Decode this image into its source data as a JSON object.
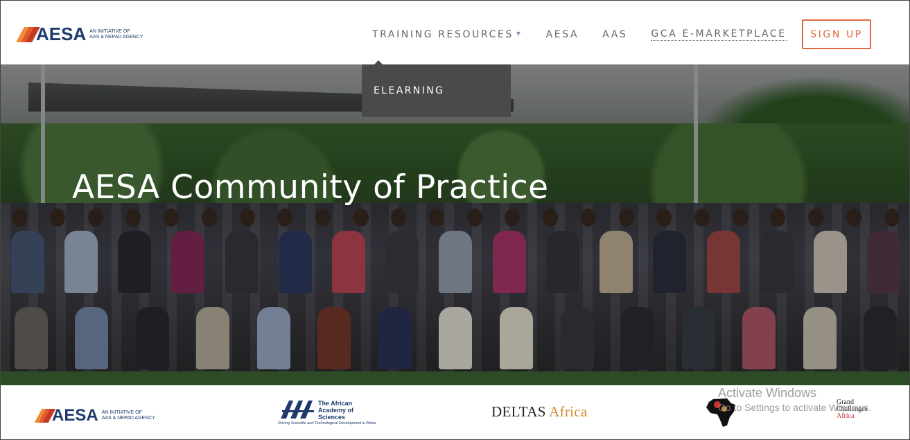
{
  "header": {
    "logo": {
      "word": "AESA",
      "tagline_1": "AN INITIATIVE OF",
      "tagline_2": "AAS & NEPAD AGENCY",
      "icon": "aesa-logo-icon"
    },
    "nav": [
      {
        "label": "TRAINING RESOURCES",
        "has_dropdown": true
      },
      {
        "label": "AESA"
      },
      {
        "label": "AAS"
      },
      {
        "label": "GCA E-MARKETPLACE"
      }
    ],
    "signup_label": "SIGN UP"
  },
  "dropdown": {
    "items": [
      {
        "label": "ELEARNING"
      }
    ]
  },
  "hero": {
    "title": "AESA Community of Practice",
    "image": "group-photo-conference-attendees"
  },
  "partners": {
    "aesa": {
      "word": "AESA",
      "tagline_1": "AN INITIATIVE OF",
      "tagline_2": "AAS & NEPAD AGENCY"
    },
    "aas": {
      "name_1": "The African",
      "name_2": "Academy of Sciences",
      "motto": "Driving Scientific and Technological Development in Africa"
    },
    "deltas": {
      "word": "DELTAS",
      "africa": "Africa"
    },
    "h3": {
      "icon": "h3africa-map-icon"
    },
    "grand_challenges": {
      "line1": "Grand",
      "line2": "Challenges",
      "line3": "Africa"
    }
  },
  "watermark": {
    "line1": "Activate Windows",
    "line2": "Go to Settings to activate Windows."
  },
  "colors": {
    "brand_navy": "#1e3a6b",
    "brand_orange": "#e06a3e",
    "dropdown_bg": "#4a4a4a"
  }
}
